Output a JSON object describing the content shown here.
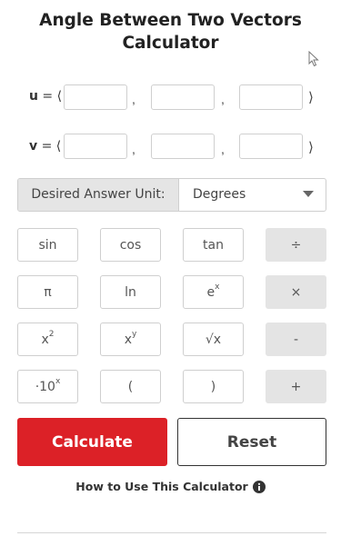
{
  "title": "Angle Between Two Vectors Calculator",
  "vectors": {
    "u_name": "u",
    "v_name": "v",
    "prefix": " = ⟨",
    "separator": ",",
    "suffix": "⟩"
  },
  "unit": {
    "label": "Desired Answer Unit:",
    "selected": "Degrees"
  },
  "keypad": {
    "sin": "sin",
    "cos": "cos",
    "tan": "tan",
    "divide": "÷",
    "pi": "π",
    "ln": "ln",
    "e_base": "e",
    "e_exp": "x",
    "multiply": "×",
    "x2_base": "x",
    "x2_exp": "2",
    "xy_base": "x",
    "xy_exp": "y",
    "sqrt": "√x",
    "minus": "-",
    "ten_base": "·10",
    "ten_exp": "x",
    "lparen": "(",
    "rparen": ")",
    "plus": "+"
  },
  "buttons": {
    "calculate": "Calculate",
    "reset": "Reset"
  },
  "howto": "How to Use This Calculator",
  "icons": {
    "info": "info-icon",
    "caret": "chevron-down-icon",
    "cursor": "mouse-pointer-icon"
  },
  "colors": {
    "accent": "#dc2127",
    "operator_key": "#e4e4e4",
    "label_bg": "#e5e5e5"
  }
}
